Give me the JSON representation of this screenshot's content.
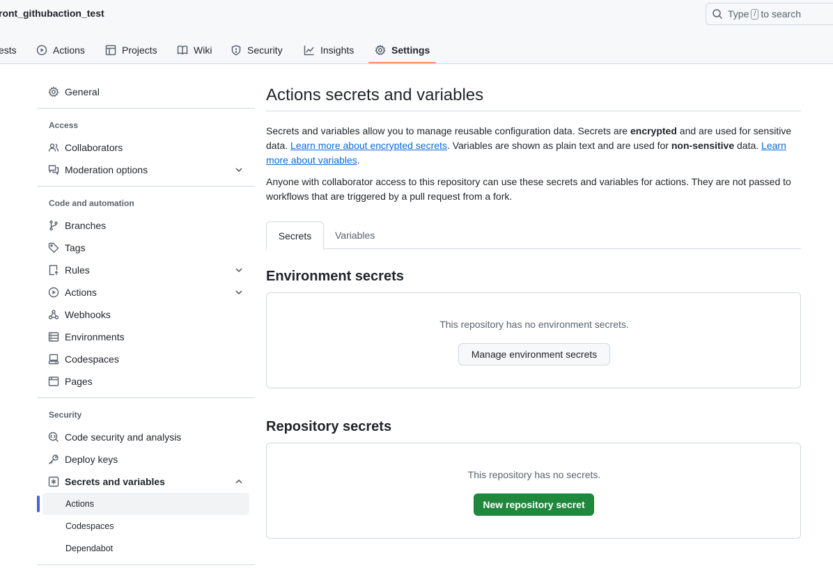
{
  "header": {
    "repo_name": "ront_githubaction_test",
    "search": {
      "prefix": "Type",
      "key": "/",
      "suffix": "to search"
    }
  },
  "repo_tabs": [
    {
      "label": "ests",
      "icon": "pull-request-icon"
    },
    {
      "label": "Actions",
      "icon": "play-icon"
    },
    {
      "label": "Projects",
      "icon": "table-icon"
    },
    {
      "label": "Wiki",
      "icon": "book-icon"
    },
    {
      "label": "Security",
      "icon": "shield-icon"
    },
    {
      "label": "Insights",
      "icon": "graph-icon"
    },
    {
      "label": "Settings",
      "icon": "gear-icon",
      "active": true
    }
  ],
  "sidebar": {
    "general": "General",
    "access_label": "Access",
    "collaborators": "Collaborators",
    "moderation": "Moderation options",
    "code_label": "Code and automation",
    "branches": "Branches",
    "tags": "Tags",
    "rules": "Rules",
    "actions": "Actions",
    "webhooks": "Webhooks",
    "environments": "Environments",
    "codespaces": "Codespaces",
    "pages": "Pages",
    "security_label": "Security",
    "code_security": "Code security and analysis",
    "deploy_keys": "Deploy keys",
    "secrets_vars": "Secrets and variables",
    "sub_actions": "Actions",
    "sub_codespaces": "Codespaces",
    "sub_dependabot": "Dependabot"
  },
  "main": {
    "title": "Actions secrets and variables",
    "p1_a": "Secrets and variables allow you to manage reusable configuration data. Secrets are ",
    "p1_b": "encrypted",
    "p1_c": " and are used for sensitive data. ",
    "p1_link1": "Learn more about encrypted secrets",
    "p1_d": ". Variables are shown as plain text and are used for ",
    "p1_e": "non-sensitive",
    "p1_f": " data. ",
    "p1_link2": "Learn more about variables",
    "p1_g": ".",
    "p2": "Anyone with collaborator access to this repository can use these secrets and variables for actions. They are not passed to workflows that are triggered by a pull request from a fork.",
    "tab_secrets": "Secrets",
    "tab_variables": "Variables",
    "env_heading": "Environment secrets",
    "env_empty": "This repository has no environment secrets.",
    "env_button": "Manage environment secrets",
    "repo_heading": "Repository secrets",
    "repo_empty": "This repository has no secrets.",
    "repo_button": "New repository secret"
  },
  "colors": {
    "accent_underline": "#fd8c73",
    "primary_button": "#1f883d",
    "link": "#0969da",
    "active_indicator": "#4f5fd6"
  }
}
